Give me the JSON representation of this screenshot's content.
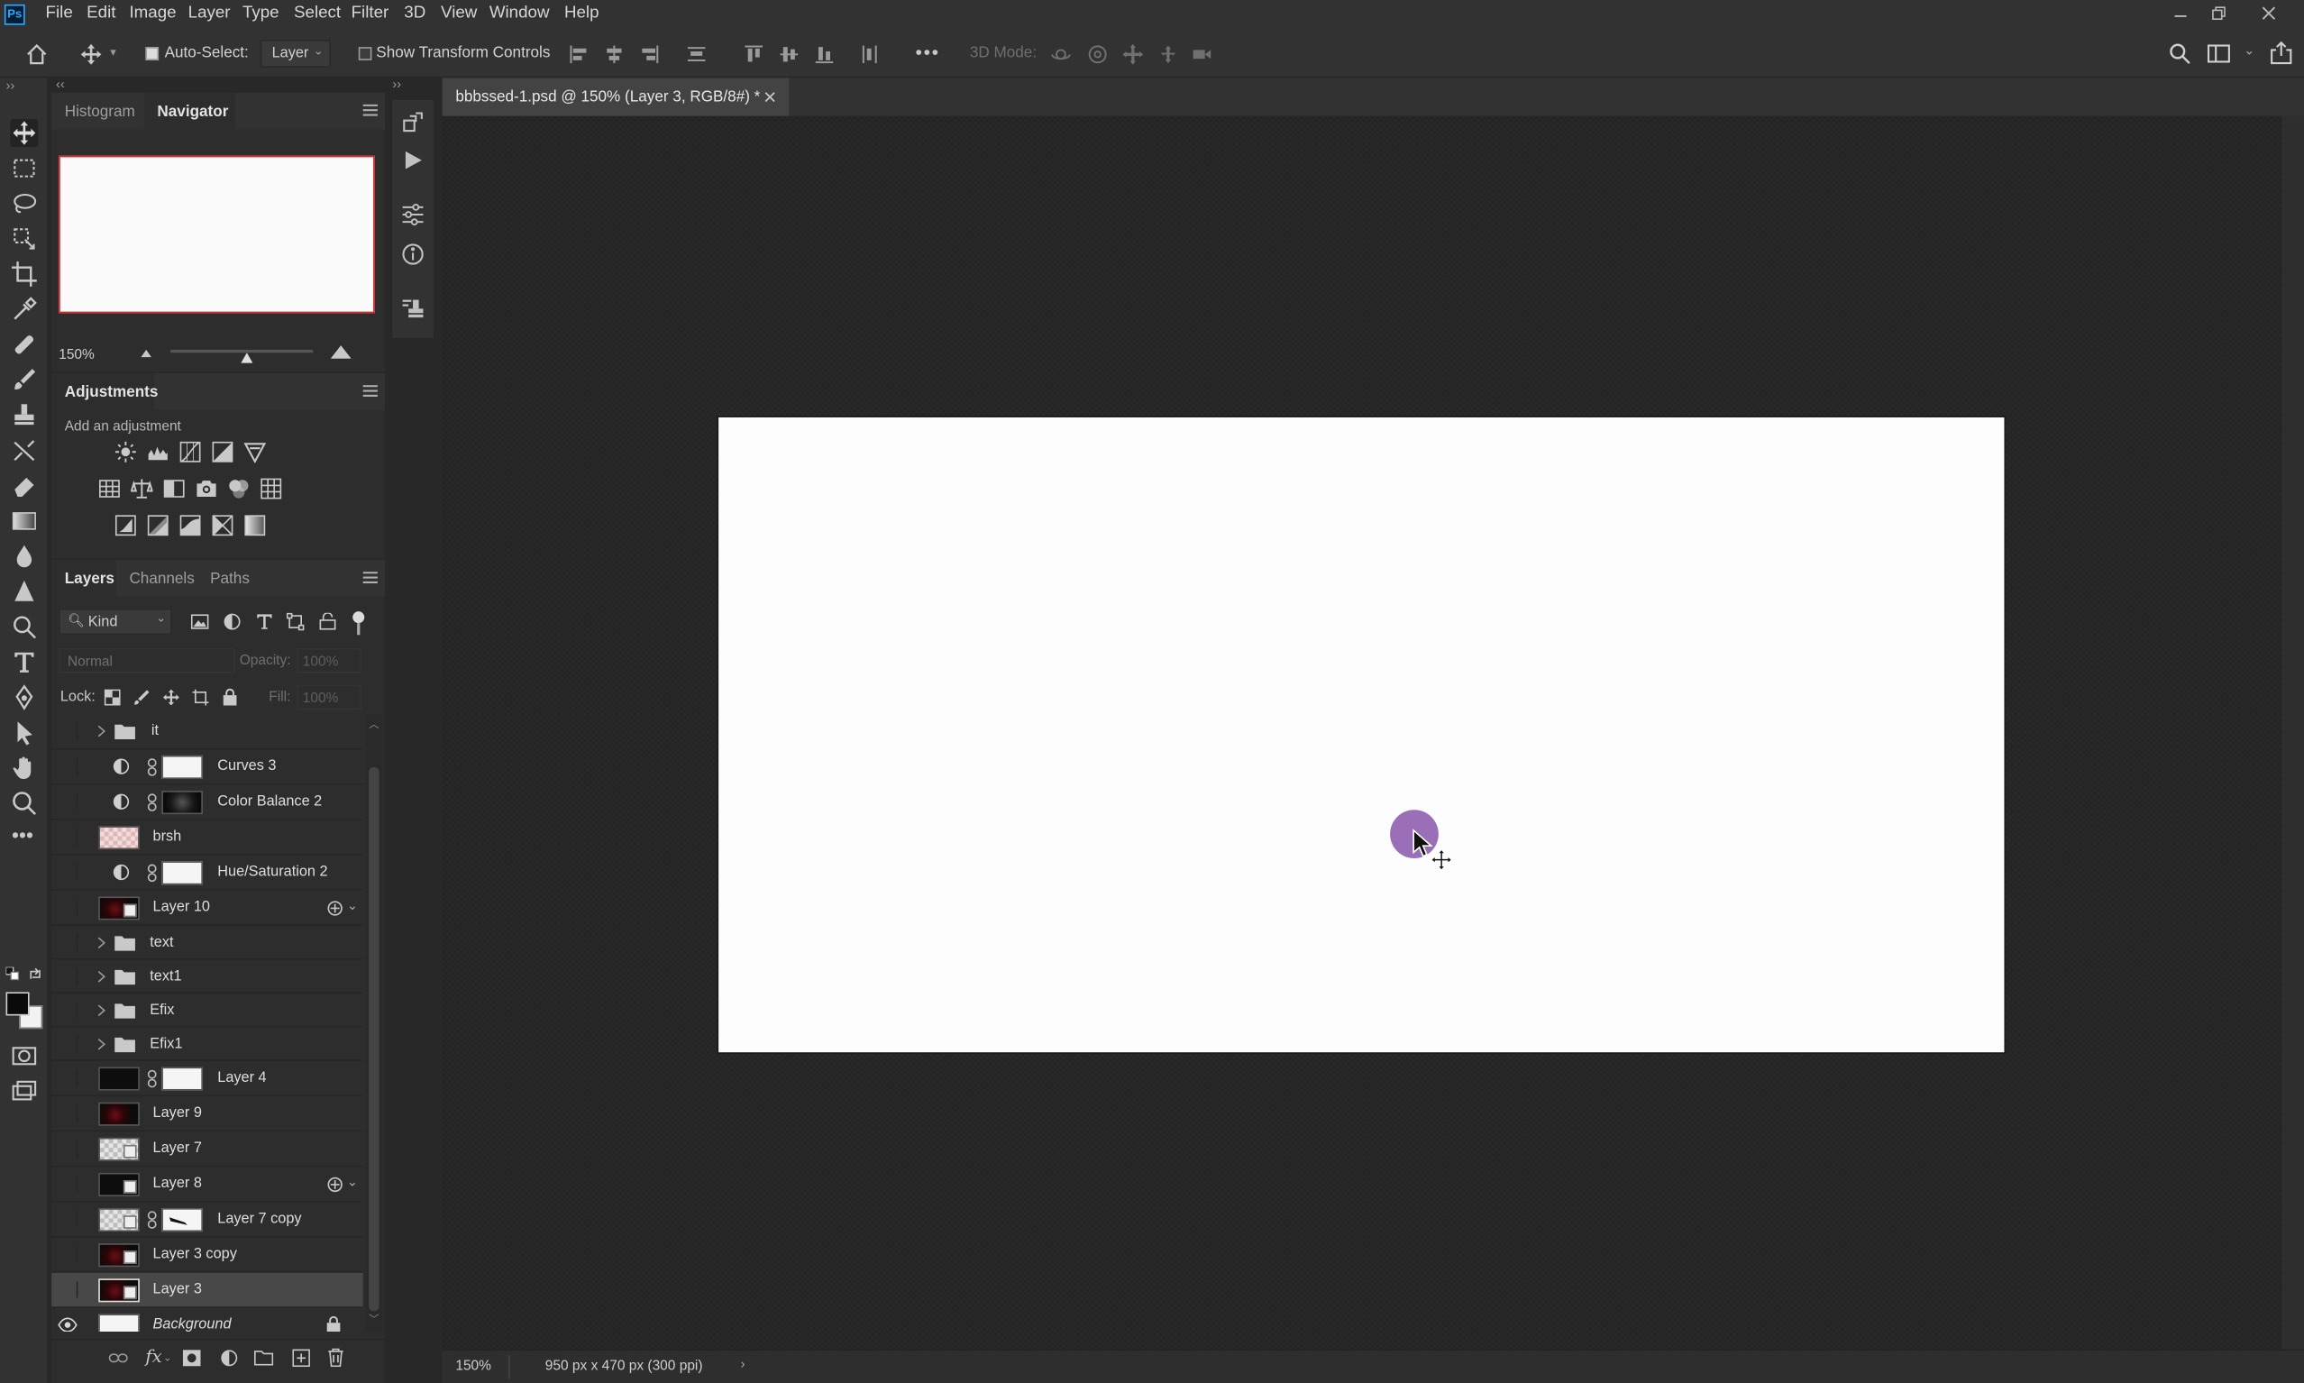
{
  "app": {
    "logo": "Ps",
    "menu": [
      "File",
      "Edit",
      "Image",
      "Layer",
      "Type",
      "Select",
      "Filter",
      "3D",
      "View",
      "Window",
      "Help"
    ]
  },
  "options": {
    "auto_select_label": "Auto-Select:",
    "auto_select_checked": true,
    "auto_select_target": "Layer",
    "show_transform_label": "Show Transform Controls",
    "show_transform_checked": false,
    "more": "•••",
    "mode_3d_label": "3D Mode:"
  },
  "panels": {
    "top_tabs": [
      "Histogram",
      "Navigator"
    ],
    "active_top_tab": "Navigator",
    "navigator_zoom": "150%",
    "adjustments_title": "Adjustments",
    "adjustments_hint": "Add an adjustment",
    "layer_tabs": [
      "Layers",
      "Channels",
      "Paths"
    ],
    "layers_filter_kind": "Kind",
    "blend_mode": "Normal",
    "opacity_label": "Opacity:",
    "opacity_value": "100%",
    "lock_label": "Lock:",
    "fill_label": "Fill:",
    "fill_value": "100%"
  },
  "layers": [
    {
      "name": "it",
      "type": "group"
    },
    {
      "name": "Curves 3",
      "type": "adjustment",
      "mask": "white"
    },
    {
      "name": "Color Balance 2",
      "type": "adjustment",
      "mask": "dark"
    },
    {
      "name": "brsh",
      "type": "raster",
      "thumb": "pinkcheck"
    },
    {
      "name": "Hue/Saturation 2",
      "type": "adjustment",
      "mask": "white"
    },
    {
      "name": "Layer 10",
      "type": "smart",
      "thumb": "red",
      "linked_badge": true
    },
    {
      "name": "text",
      "type": "group"
    },
    {
      "name": "text1",
      "type": "group"
    },
    {
      "name": "Efix",
      "type": "group"
    },
    {
      "name": "Efix1",
      "type": "group"
    },
    {
      "name": "Layer 4",
      "type": "masked",
      "thumb": "dark",
      "mask": "white"
    },
    {
      "name": "Layer 9",
      "type": "raster",
      "thumb": "red"
    },
    {
      "name": "Layer 7",
      "type": "smart",
      "thumb": "checker"
    },
    {
      "name": "Layer 8",
      "type": "smart",
      "thumb": "dark",
      "linked_badge": true
    },
    {
      "name": "Layer 7 copy",
      "type": "smart-masked",
      "thumb": "checker",
      "mask": "white"
    },
    {
      "name": "Layer 3 copy",
      "type": "smart",
      "thumb": "red"
    },
    {
      "name": "Layer 3",
      "type": "smart",
      "thumb": "red",
      "selected": true
    },
    {
      "name": "Background",
      "type": "background",
      "thumb": "white",
      "visible": true,
      "locked": true
    }
  ],
  "document": {
    "tab_title": "bbbssed-1.psd @ 150% (Layer 3, RGB/8#) *",
    "zoom": "150%",
    "dimensions": "950 px x 470 px (300 ppi)"
  },
  "colors": {
    "accent": "#31a8ff",
    "cursor_circle": "#9a6fb8",
    "navigator_frame": "#e0262b"
  }
}
